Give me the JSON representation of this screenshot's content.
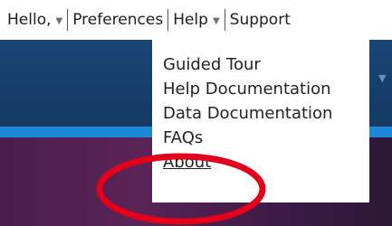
{
  "nav": {
    "hello_label": "Hello,",
    "preferences_label": "Preferences",
    "help_label": "Help",
    "support_label": "Support"
  },
  "help_menu": {
    "items": [
      "Guided Tour",
      "Help Documentation",
      "Data Documentation",
      "FAQs",
      "About"
    ]
  },
  "colors": {
    "header_navy": "#18406c",
    "accent_blue": "#1e88d8",
    "footer_purple": "#4a1e4a",
    "annotation_red": "#e3001b"
  },
  "icons": {
    "caret": "chevron-down-icon"
  }
}
